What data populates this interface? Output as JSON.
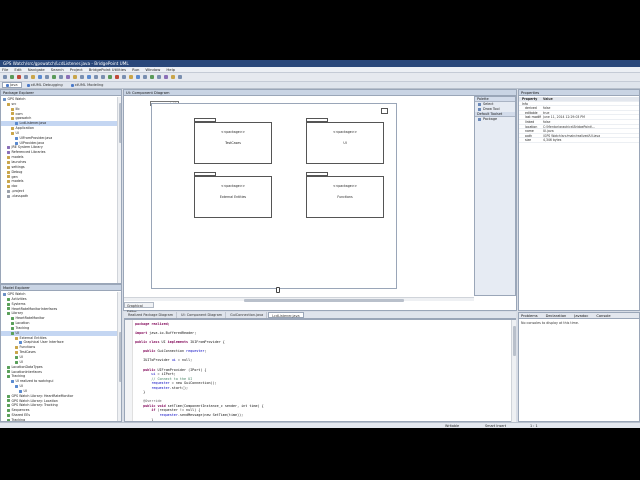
{
  "window": {
    "title": "GPS Watch/src/gpswatch/LcdListener.java - BridgePoint UML"
  },
  "menu": [
    "File",
    "Edit",
    "Navigate",
    "Search",
    "Project",
    "BridgePoint Utilities",
    "Run",
    "Window",
    "Help"
  ],
  "perspectives": [
    {
      "label": "Java",
      "active": true
    },
    {
      "label": "xtUML Debugging",
      "active": false
    },
    {
      "label": "xtUML Modeling",
      "active": false
    }
  ],
  "model_explorer": {
    "tab": "Package Explorer",
    "items": [
      {
        "label": "GPS Watch",
        "indent": 0,
        "color": "#6a8fc4"
      },
      {
        "label": "src",
        "indent": 1,
        "color": "#c9a54a"
      },
      {
        "label": "lib",
        "indent": 2,
        "color": "#c9a54a"
      },
      {
        "label": "com",
        "indent": 2,
        "color": "#c9a54a"
      },
      {
        "label": "gpswatch",
        "indent": 2,
        "color": "#c9a54a"
      },
      {
        "label": "LcdListener.java",
        "indent": 3,
        "color": "#5a8ad0",
        "selected": true
      },
      {
        "label": "Application",
        "indent": 2,
        "color": "#c9a54a"
      },
      {
        "label": "UI",
        "indent": 2,
        "color": "#c9a54a"
      },
      {
        "label": "UIFromProvider.java",
        "indent": 3,
        "color": "#5a8ad0"
      },
      {
        "label": "UIProvider.java",
        "indent": 3,
        "color": "#5a8ad0"
      },
      {
        "label": "JRE System Library",
        "indent": 1,
        "color": "#8a6fb8"
      },
      {
        "label": "Referenced Libraries",
        "indent": 1,
        "color": "#8a6fb8"
      },
      {
        "label": "models",
        "indent": 1,
        "color": "#c9a54a"
      },
      {
        "label": "launches",
        "indent": 1,
        "color": "#c9a54a"
      },
      {
        "label": "settings",
        "indent": 1,
        "color": "#c9a54a"
      },
      {
        "label": "Debug",
        "indent": 1,
        "color": "#c9a54a"
      },
      {
        "label": "gen",
        "indent": 1,
        "color": "#c9a54a"
      },
      {
        "label": "models",
        "indent": 1,
        "color": "#c9a54a"
      },
      {
        "label": "doc",
        "indent": 1,
        "color": "#c9a54a"
      },
      {
        "label": ".project",
        "indent": 1,
        "color": "#9aa0aa"
      },
      {
        "label": ".classpath",
        "indent": 1,
        "color": "#9aa0aa"
      }
    ]
  },
  "model_tree": {
    "tab": "Model Explorer",
    "items": [
      {
        "label": "GPS Watch",
        "indent": 0,
        "color": "#6a8fc4"
      },
      {
        "label": "Activities",
        "indent": 1,
        "color": "#5aa05a"
      },
      {
        "label": "Systems",
        "indent": 1,
        "color": "#5aa05a"
      },
      {
        "label": "HeartRateMonitorInterfaces",
        "indent": 1,
        "color": "#5aa05a"
      },
      {
        "label": "Library",
        "indent": 1,
        "color": "#5aa05a"
      },
      {
        "label": "HeartRateMonitor",
        "indent": 2,
        "color": "#5aa05a"
      },
      {
        "label": "Location",
        "indent": 2,
        "color": "#5aa05a"
      },
      {
        "label": "Tracking",
        "indent": 2,
        "color": "#5aa05a"
      },
      {
        "label": "UI",
        "indent": 2,
        "color": "#5aa05a",
        "selected": true
      },
      {
        "label": "External Entities",
        "indent": 3,
        "color": "#c9a54a"
      },
      {
        "label": "Graphical User Interface",
        "indent": 4,
        "color": "#5a8ad0"
      },
      {
        "label": "Functions",
        "indent": 3,
        "color": "#c9a54a"
      },
      {
        "label": "TestCases",
        "indent": 3,
        "color": "#c9a54a"
      },
      {
        "label": "UI",
        "indent": 3,
        "color": "#5aa05a"
      },
      {
        "label": "UI",
        "indent": 3,
        "color": "#5aa05a"
      },
      {
        "label": "LocationDataTypes",
        "indent": 1,
        "color": "#5aa05a"
      },
      {
        "label": "LocationInterfaces",
        "indent": 1,
        "color": "#5aa05a"
      },
      {
        "label": "Tracking",
        "indent": 1,
        "color": "#5aa05a"
      },
      {
        "label": "UI realized to watchgui",
        "indent": 2,
        "color": "#5a8ad0"
      },
      {
        "label": "UI",
        "indent": 3,
        "color": "#5a8ad0"
      },
      {
        "label": "UI",
        "indent": 4,
        "color": "#5a8ad0"
      },
      {
        "label": "GPS Watch Library: HeartRateMonitor",
        "indent": 1,
        "color": "#5aa05a"
      },
      {
        "label": "GPS Watch Library: Location",
        "indent": 1,
        "color": "#5aa05a"
      },
      {
        "label": "GPS Watch Library: Tracking",
        "indent": 1,
        "color": "#5aa05a"
      },
      {
        "label": "Sequences",
        "indent": 1,
        "color": "#5aa05a"
      },
      {
        "label": "Shared EEs",
        "indent": 1,
        "color": "#5aa05a"
      },
      {
        "label": "Tracking",
        "indent": 1,
        "color": "#5aa05a"
      },
      {
        "label": "Utilities",
        "indent": 1,
        "color": "#5aa05a"
      },
      {
        "label": "UIDataTypes",
        "indent": 1,
        "color": "#5aa05a"
      },
      {
        "label": "UIInterfaces",
        "indent": 1,
        "color": "#5aa05a"
      }
    ]
  },
  "diagram": {
    "tab": "UI: Component Diagram",
    "frame_label": "component: UI",
    "bottom_tab": "Graphical Editor",
    "packages": [
      {
        "stereotype": "<<package>>",
        "name": "TestCases"
      },
      {
        "stereotype": "<<package>>",
        "name": "UI"
      },
      {
        "stereotype": "<<package>>",
        "name": "External Entities"
      },
      {
        "stereotype": "<<package>>",
        "name": "Functions"
      }
    ]
  },
  "palette": {
    "header": "Palette",
    "tools": [
      "Select",
      "Draw Tool"
    ],
    "section": "Default Toolset",
    "items": [
      "Package"
    ]
  },
  "editor_tabs": [
    {
      "label": "Realized Package Diagram",
      "active": false
    },
    {
      "label": "UI: Component Diagram",
      "active": false
    },
    {
      "label": "GuiConnection.java",
      "active": false
    },
    {
      "label": "LcdListener.java",
      "active": true
    }
  ],
  "code_lines": [
    [
      {
        "t": "package realized;",
        "c": "kw"
      }
    ],
    [
      {
        "t": "",
        "c": ""
      }
    ],
    [
      {
        "t": "import",
        "c": "kw"
      },
      {
        "t": " java.io.BufferedReader;",
        "c": ""
      }
    ],
    [
      {
        "t": "",
        "c": ""
      }
    ],
    [
      {
        "t": "public class",
        "c": "kw"
      },
      {
        "t": " UI ",
        "c": ""
      },
      {
        "t": "implements",
        "c": "kw"
      },
      {
        "t": " IUIFromProvider {",
        "c": ""
      }
    ],
    [
      {
        "t": "",
        "c": ""
      }
    ],
    [
      {
        "t": "    public",
        "c": "kw"
      },
      {
        "t": " GuiConnection ",
        "c": ""
      },
      {
        "t": "requester",
        "c": "fld"
      },
      {
        "t": ";",
        "c": ""
      }
    ],
    [
      {
        "t": "",
        "c": ""
      }
    ],
    [
      {
        "t": "    IUIToProvider ",
        "c": ""
      },
      {
        "t": "ui",
        "c": "fld"
      },
      {
        "t": " = null;",
        "c": ""
      }
    ],
    [
      {
        "t": "",
        "c": ""
      }
    ],
    [
      {
        "t": "    public",
        "c": "kw"
      },
      {
        "t": " UIFromProvider (IPort) {",
        "c": ""
      }
    ],
    [
      {
        "t": "        ",
        "c": ""
      },
      {
        "t": "ui",
        "c": "fld"
      },
      {
        "t": " = iIPort;",
        "c": ""
      }
    ],
    [
      {
        "t": "        // Connect to the UI",
        "c": "cm"
      }
    ],
    [
      {
        "t": "        ",
        "c": ""
      },
      {
        "t": "requester",
        "c": "fld"
      },
      {
        "t": " = new GuiConnection();",
        "c": ""
      }
    ],
    [
      {
        "t": "        ",
        "c": ""
      },
      {
        "t": "requester",
        "c": "fld"
      },
      {
        "t": ".start();",
        "c": ""
      }
    ],
    [
      {
        "t": "    }",
        "c": ""
      }
    ],
    [
      {
        "t": "",
        "c": ""
      }
    ],
    [
      {
        "t": "    @Override",
        "c": "an"
      }
    ],
    [
      {
        "t": "    public void",
        "c": "kw"
      },
      {
        "t": " setTime(ComponentInstance_c sender, int time) {",
        "c": ""
      }
    ],
    [
      {
        "t": "        if",
        "c": "kw"
      },
      {
        "t": " (requester != null) {",
        "c": ""
      }
    ],
    [
      {
        "t": "            ",
        "c": ""
      },
      {
        "t": "requester",
        "c": "fld"
      },
      {
        "t": ".sendMessage(new SetTime(time));",
        "c": ""
      }
    ],
    [
      {
        "t": "        }",
        "c": ""
      }
    ],
    [
      {
        "t": "    }",
        "c": ""
      }
    ],
    [
      {
        "t": "",
        "c": ""
      }
    ],
    [
      {
        "t": "    @Override",
        "c": "an"
      }
    ],
    [
      {
        "t": "    public void",
        "c": "kw"
      },
      {
        "t": " setData(ComponentInstance_c sender, double value, Unit unit) {",
        "c": ""
      }
    ],
    [
      {
        "t": "        LcdPlugin.out.println(",
        "c": ""
      },
      {
        "t": "\"value: \"",
        "c": "str"
      },
      {
        "t": " + value + ",
        "c": ""
      },
      {
        "t": "\" Unit: \"",
        "c": "str"
      },
      {
        "t": " + unit);",
        "c": ""
      }
    ],
    [
      {
        "t": "        if",
        "c": "kw"
      },
      {
        "t": " (requester != null) {",
        "c": ""
      }
    ]
  ],
  "properties": {
    "tab": "Properties",
    "columns": [
      "Property",
      "Value"
    ],
    "section": "Info",
    "rows": [
      {
        "key": "derived",
        "value": "false"
      },
      {
        "key": "editable",
        "value": "true"
      },
      {
        "key": "last modified",
        "value": "June 11, 2014 12:29:03 PM"
      },
      {
        "key": "linked",
        "value": "false"
      },
      {
        "key": "location",
        "value": "C:\\Mentor\\graphics\\BridgePoint\\..."
      },
      {
        "key": "name",
        "value": "UI.java"
      },
      {
        "key": "path",
        "value": "/GPS Watch/src/main/realized/UI.java"
      },
      {
        "key": "size",
        "value": "4,346 bytes"
      }
    ]
  },
  "console": {
    "tabs": [
      "Problems",
      "Declaration",
      "Javadoc",
      "Console"
    ],
    "message": "No consoles to display at this time."
  },
  "statusbar": {
    "writable": "Writable",
    "insert": "Smart Insert",
    "position": "1 : 1"
  }
}
